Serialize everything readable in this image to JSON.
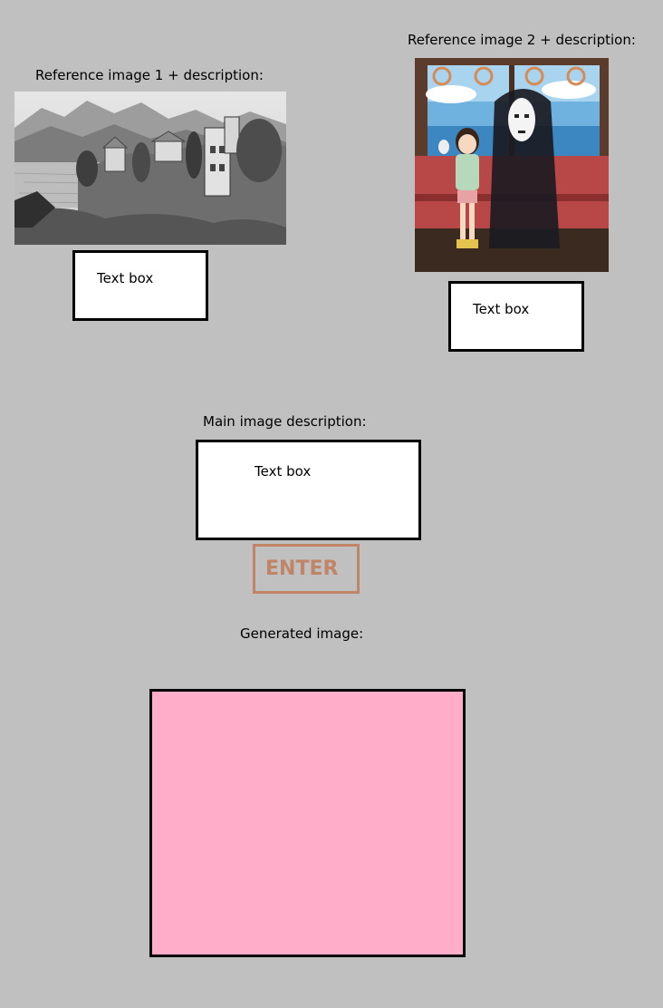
{
  "reference1": {
    "label": "Reference image 1 + description:",
    "image_icon": "sketch-lake-villa-image",
    "textbox_placeholder": "Text box"
  },
  "reference2": {
    "label": "Reference image 2 + description:",
    "image_icon": "anime-train-scene-image",
    "textbox_placeholder": "Text box"
  },
  "main": {
    "label": "Main image description:",
    "textbox_placeholder": "Text box"
  },
  "enter_button": {
    "label": "ENTER",
    "color": "#c08566"
  },
  "generated": {
    "label": "Generated image:",
    "fill_color": "#ffadc8"
  },
  "colors": {
    "background": "#c0c0c0"
  }
}
